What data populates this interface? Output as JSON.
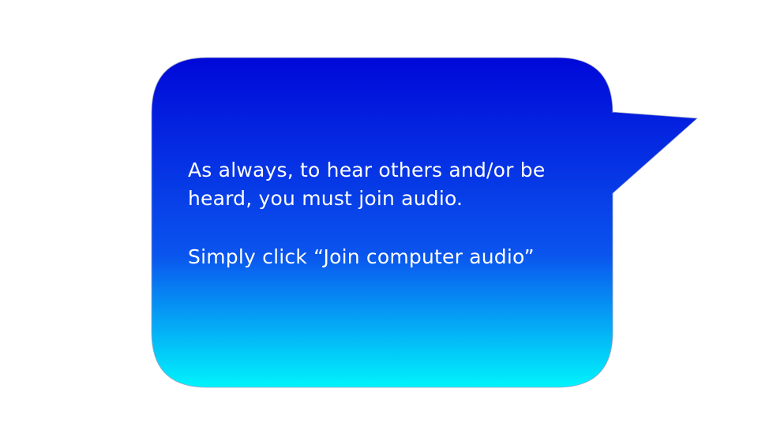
{
  "bubble": {
    "gradient_top": "#0008d8",
    "gradient_bottom": "#00f4fc",
    "paragraph1": "As always, to hear others and/or be heard, you must join audio.",
    "paragraph2": "Simply click “Join computer audio”"
  }
}
